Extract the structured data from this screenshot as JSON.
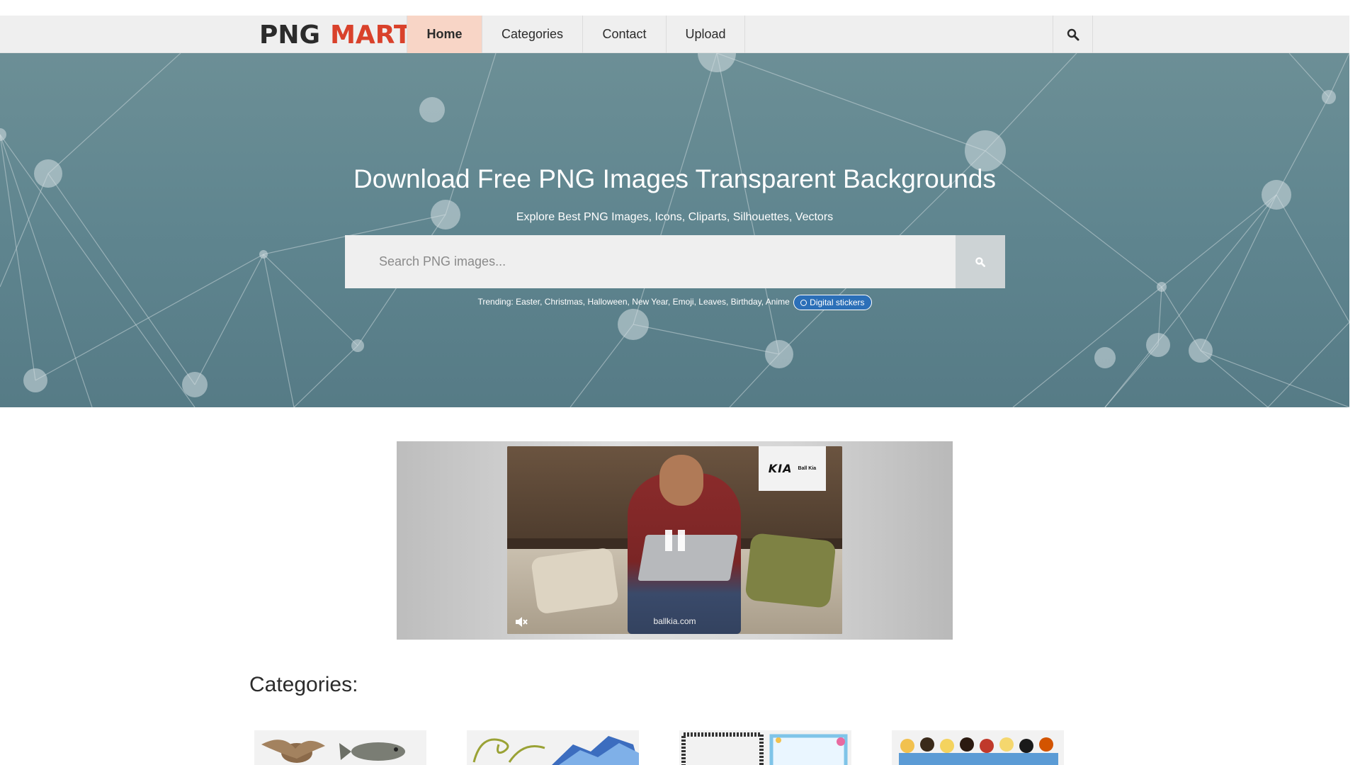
{
  "logo": {
    "part1": "PNG",
    "part2": "MART"
  },
  "nav": {
    "items": [
      {
        "label": "Home",
        "active": true
      },
      {
        "label": "Categories",
        "active": false
      },
      {
        "label": "Contact",
        "active": false
      },
      {
        "label": "Upload",
        "active": false
      }
    ],
    "search_icon": "magnifier-icon"
  },
  "hero": {
    "title": "Download Free PNG Images Transparent Backgrounds",
    "subtitle": "Explore Best PNG Images, Icons, Cliparts, Silhouettes, Vectors",
    "search_placeholder": "Search PNG images...",
    "search_button_icon": "magnifier-icon",
    "trending_label": "Trending:",
    "trending_items": [
      "Easter",
      "Christmas",
      "Halloween",
      "New Year",
      "Emoji",
      "Leaves",
      "Birthday",
      "Anime"
    ],
    "pill_label": "Digital stickers"
  },
  "ad": {
    "brand": "KIA",
    "advertiser": "Ball Kia",
    "url": "ballkia.com",
    "controls": [
      "pause-icon",
      "mute-icon"
    ]
  },
  "categories": {
    "title": "Categories:",
    "thumbnails": [
      "animals",
      "swirls-and-waves",
      "frames-and-borders",
      "princesses"
    ]
  },
  "colors": {
    "logo_accent": "#d9412b",
    "nav_active_bg": "#f8d5c6",
    "hero_bg": "#5f858f",
    "pill_bg": "#2b6fb8"
  }
}
